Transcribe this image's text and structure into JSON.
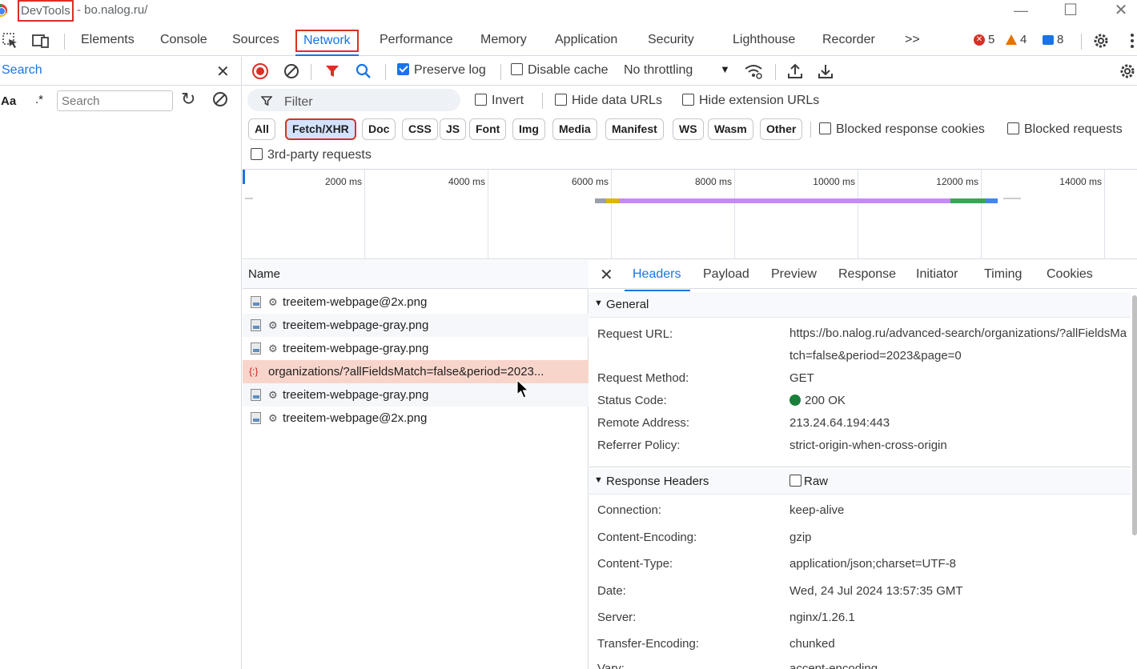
{
  "window": {
    "app_title": "DevTools",
    "url_suffix": "- bo.nalog.ru/",
    "minimize": "—",
    "maximize": "☐",
    "close": "✕"
  },
  "tabs": [
    "Elements",
    "Console",
    "Sources",
    "Network",
    "Performance",
    "Memory",
    "Application",
    "Security",
    "Lighthouse",
    "Recorder"
  ],
  "more_tabs": ">>",
  "status": {
    "errors": "5",
    "warnings": "4",
    "messages": "8"
  },
  "search_panel": {
    "title": "Search",
    "case_label": "Aa",
    "regex_label": ".*",
    "input_placeholder": "Search"
  },
  "network_toolbar": {
    "preserve_log": "Preserve log",
    "disable_cache": "Disable cache",
    "throttling": "No throttling"
  },
  "filter_row": {
    "placeholder": "Filter",
    "invert": "Invert",
    "hide_data_urls": "Hide data URLs",
    "hide_extension_urls": "Hide extension URLs"
  },
  "type_filters": [
    "All",
    "Fetch/XHR",
    "Doc",
    "CSS",
    "JS",
    "Font",
    "Img",
    "Media",
    "Manifest",
    "WS",
    "Wasm",
    "Other"
  ],
  "active_type_filter": "Fetch/XHR",
  "blocked_response_cookies": "Blocked response cookies",
  "blocked_requests": "Blocked requests",
  "third_party": "3rd-party requests",
  "overview_ticks": [
    "2000 ms",
    "4000 ms",
    "6000 ms",
    "8000 ms",
    "10000 ms",
    "12000 ms",
    "14000 ms"
  ],
  "request_list": {
    "header": "Name",
    "rows": [
      "treeitem-webpage@2x.png",
      "treeitem-webpage-gray.png",
      "treeitem-webpage-gray.png",
      "organizations/?allFieldsMatch=false&period=2023...",
      "treeitem-webpage-gray.png",
      "treeitem-webpage@2x.png"
    ],
    "selected_index": 3
  },
  "details": {
    "tabs": [
      "Headers",
      "Payload",
      "Preview",
      "Response",
      "Initiator",
      "Timing",
      "Cookies"
    ],
    "general_title": "General",
    "general": {
      "request_url_key": "Request URL:",
      "request_url": "https://bo.nalog.ru/advanced-search/organizations/?allFieldsMatch=false&period=2023&page=0",
      "method_key": "Request Method:",
      "method": "GET",
      "status_key": "Status Code:",
      "status": "200 OK",
      "remote_key": "Remote Address:",
      "remote": "213.24.64.194:443",
      "referrer_key": "Referrer Policy:",
      "referrer": "strict-origin-when-cross-origin"
    },
    "response_headers_title": "Response Headers",
    "raw_label": "Raw",
    "response_headers": [
      {
        "k": "Connection:",
        "v": "keep-alive"
      },
      {
        "k": "Content-Encoding:",
        "v": "gzip"
      },
      {
        "k": "Content-Type:",
        "v": "application/json;charset=UTF-8"
      },
      {
        "k": "Date:",
        "v": "Wed, 24 Jul 2024 13:57:35 GMT"
      },
      {
        "k": "Server:",
        "v": "nginx/1.26.1"
      },
      {
        "k": "Transfer-Encoding:",
        "v": "chunked"
      },
      {
        "k": "Vary:",
        "v": "accept-encoding"
      }
    ]
  },
  "colors": {
    "accent": "#1a73e8",
    "highlight": "#d93025",
    "selected_row": "#f8d5cb",
    "status_ok": "#188038"
  }
}
